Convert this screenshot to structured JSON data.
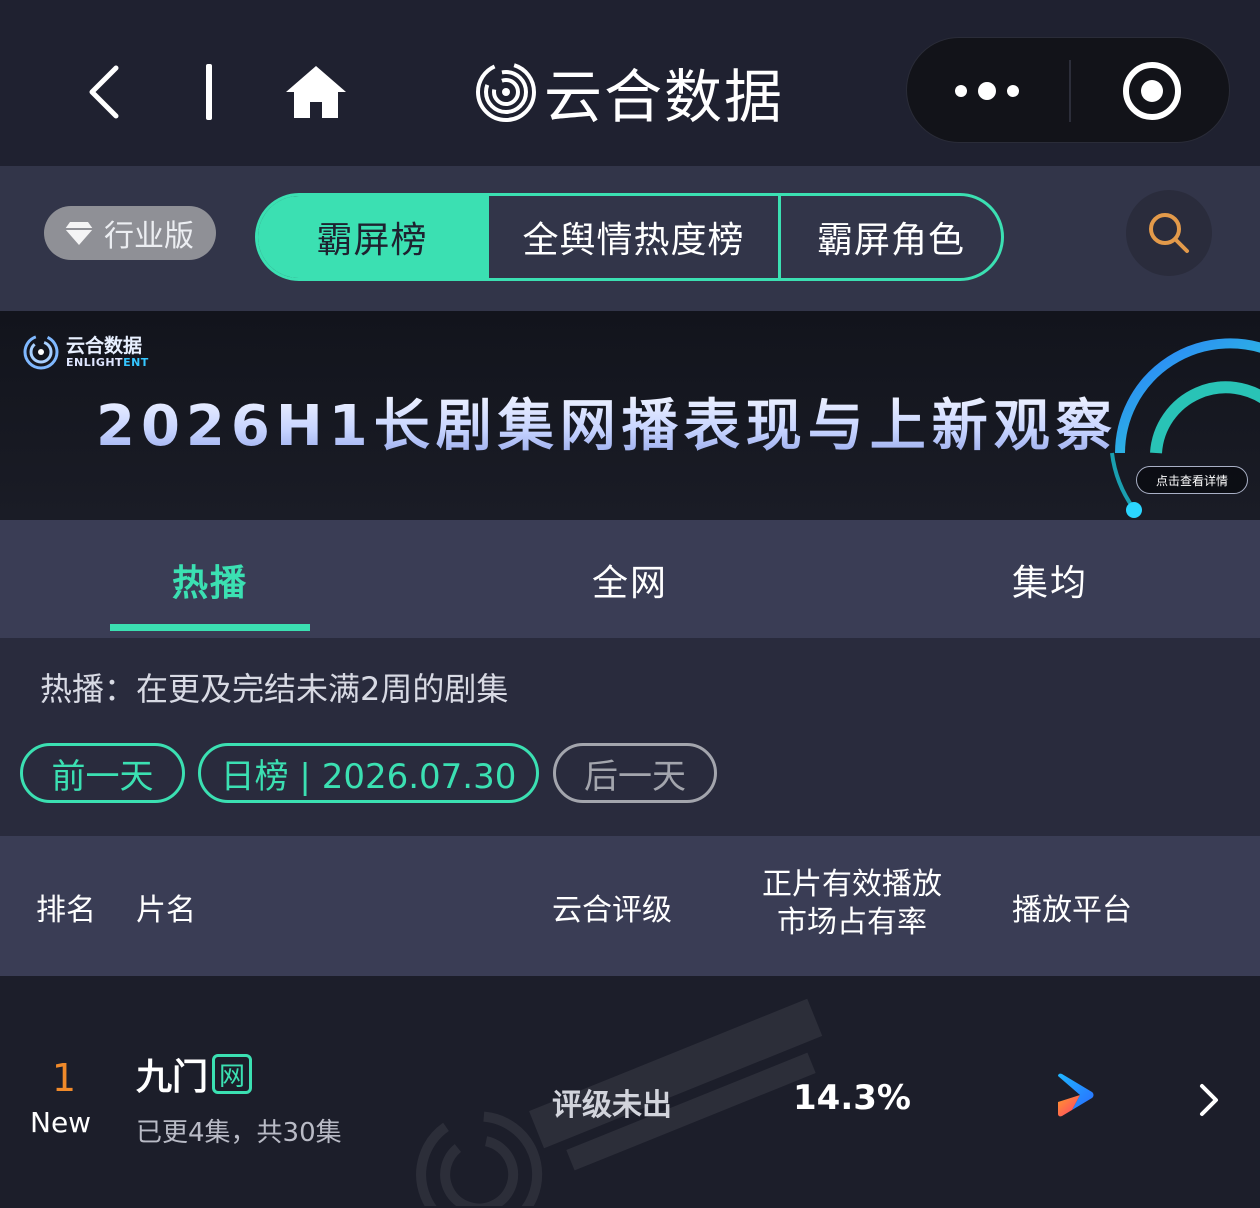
{
  "header": {
    "brand": "云合数据",
    "icons": {
      "back": "chevron-left-icon",
      "home": "home-icon",
      "more": "more-dots-icon",
      "close": "target-close-icon"
    }
  },
  "filter": {
    "edition_label": "行业版",
    "segments": [
      "霸屏榜",
      "全舆情热度榜",
      "霸屏角色"
    ],
    "active_segment": "霸屏榜",
    "icons": {
      "edition": "diamond-icon",
      "search": "search-icon"
    }
  },
  "banner": {
    "logo_cn": "云合数据",
    "logo_en_a": "ENLIGHT",
    "logo_en_b": "ENT",
    "title": "2026H1长剧集网播表现与上新观察",
    "cta": "点击查看详情"
  },
  "tabs": [
    "热播",
    "全网",
    "集均"
  ],
  "active_tab": "热播",
  "description": "热播：在更及完结未满2周的剧集",
  "date_nav": {
    "prev": "前一天",
    "current": "日榜 | 2026.07.30",
    "next": "后一天"
  },
  "table": {
    "headers": {
      "rank": "排名",
      "title": "片名",
      "grade": "云合评级",
      "share_line1": "正片有效播放",
      "share_line2": "市场占有率",
      "platform": "播放平台"
    },
    "rows": [
      {
        "rank": "1",
        "rank_tag": "New",
        "title": "九门",
        "badge": "网",
        "episodes": "已更4集，共30集",
        "grade": "评级未出",
        "share": "14.3%",
        "platform_icon": "youku-play-icon"
      }
    ]
  },
  "colors": {
    "accent": "#3be0b2",
    "rank": "#f08a2a",
    "bg": "#1c1e2a",
    "header_bg": "#3a3d55"
  }
}
